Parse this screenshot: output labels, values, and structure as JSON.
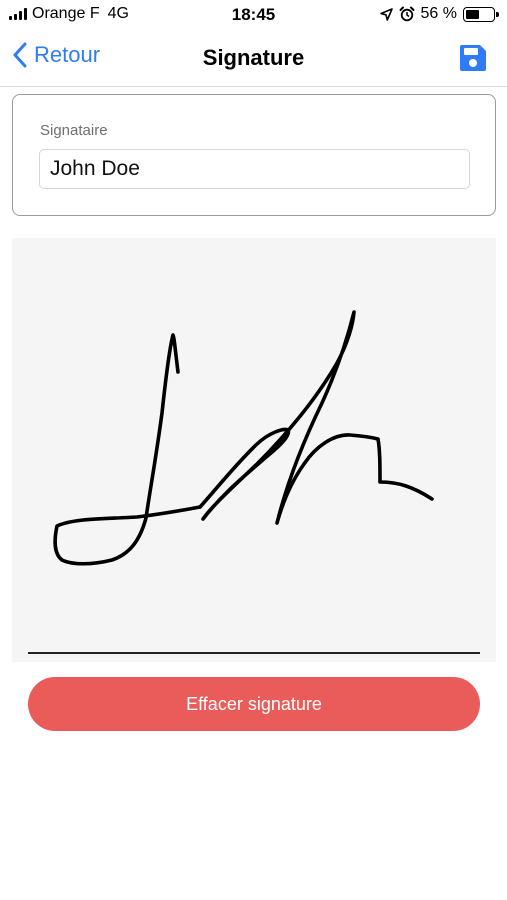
{
  "status_bar": {
    "carrier": "Orange F",
    "network": "4G",
    "time": "18:45",
    "battery_percent": "56 %",
    "battery_level": 0.56,
    "icons": [
      "signal-icon",
      "location-icon",
      "alarm-icon",
      "battery-icon"
    ]
  },
  "nav": {
    "back_label": "Retour",
    "title": "Signature",
    "save_icon": "floppy-disk-icon"
  },
  "signer": {
    "label": "Signataire",
    "value": "John Doe"
  },
  "actions": {
    "clear_label": "Effacer signature"
  },
  "colors": {
    "accent": "#2f7cf6",
    "danger": "#e95c5a",
    "pad_background": "#f5f5f5"
  }
}
